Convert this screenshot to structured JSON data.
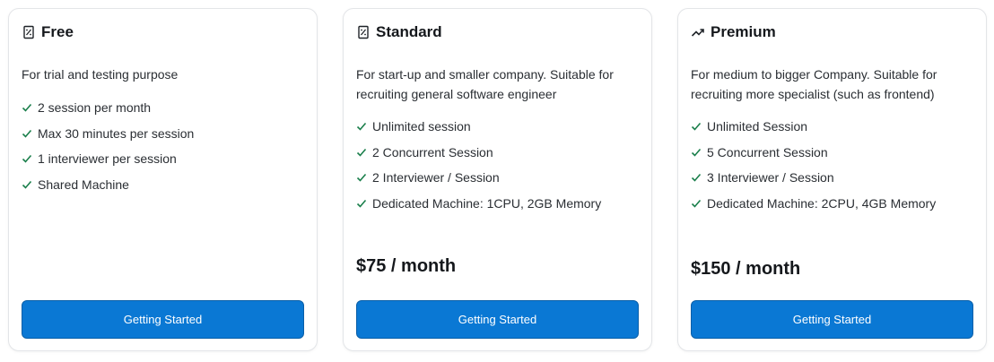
{
  "plans": [
    {
      "title": "Free",
      "icon": "receipt-icon",
      "description": "For trial and testing purpose",
      "features": [
        "2 session per month",
        "Max 30 minutes per session",
        "1 interviewer per session",
        "Shared Machine"
      ],
      "price": "",
      "button_label": "Getting Started"
    },
    {
      "title": "Standard",
      "icon": "receipt-icon",
      "description": "For start-up and smaller company. Suitable for recruiting general software engineer",
      "features": [
        "Unlimited session",
        "2 Concurrent Session",
        "2 Interviewer / Session",
        "Dedicated Machine: 1CPU, 2GB Memory"
      ],
      "price": "$75 / month",
      "button_label": "Getting Started"
    },
    {
      "title": "Premium",
      "icon": "trending-up-icon",
      "description": "For medium to bigger Company. Suitable for recruiting more specialist (such as frontend)",
      "features": [
        "Unlimited Session",
        "5 Concurrent Session",
        "3 Interviewer / Session",
        "Dedicated Machine: 2CPU, 4GB Memory"
      ],
      "price": "$150 / month",
      "button_label": "Getting Started"
    }
  ],
  "colors": {
    "accent": "#0a78d4",
    "check": "#1a7f4b",
    "border": "#e3e5e8"
  }
}
